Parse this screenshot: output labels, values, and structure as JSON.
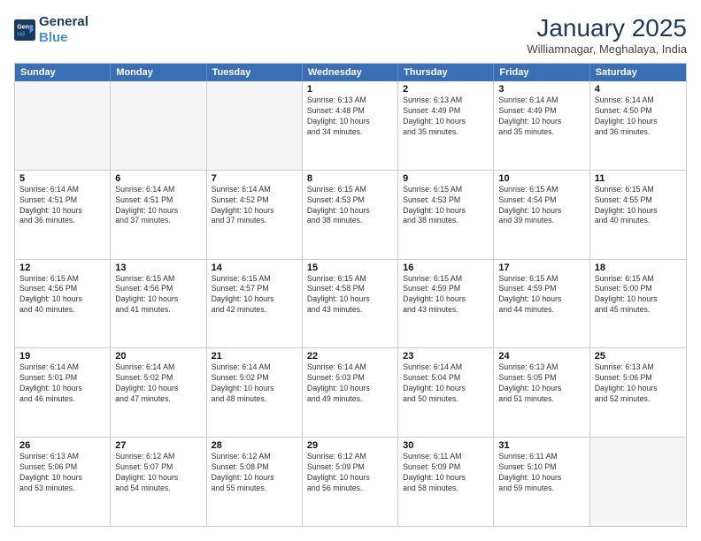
{
  "header": {
    "logo_line1": "General",
    "logo_line2": "Blue",
    "title": "January 2025",
    "subtitle": "Williamnagar, Meghalaya, India"
  },
  "days_of_week": [
    "Sunday",
    "Monday",
    "Tuesday",
    "Wednesday",
    "Thursday",
    "Friday",
    "Saturday"
  ],
  "rows": [
    [
      {
        "day": "",
        "info": ""
      },
      {
        "day": "",
        "info": ""
      },
      {
        "day": "",
        "info": ""
      },
      {
        "day": "1",
        "info": "Sunrise: 6:13 AM\nSunset: 4:48 PM\nDaylight: 10 hours\nand 34 minutes."
      },
      {
        "day": "2",
        "info": "Sunrise: 6:13 AM\nSunset: 4:49 PM\nDaylight: 10 hours\nand 35 minutes."
      },
      {
        "day": "3",
        "info": "Sunrise: 6:14 AM\nSunset: 4:49 PM\nDaylight: 10 hours\nand 35 minutes."
      },
      {
        "day": "4",
        "info": "Sunrise: 6:14 AM\nSunset: 4:50 PM\nDaylight: 10 hours\nand 36 minutes."
      }
    ],
    [
      {
        "day": "5",
        "info": "Sunrise: 6:14 AM\nSunset: 4:51 PM\nDaylight: 10 hours\nand 36 minutes."
      },
      {
        "day": "6",
        "info": "Sunrise: 6:14 AM\nSunset: 4:51 PM\nDaylight: 10 hours\nand 37 minutes."
      },
      {
        "day": "7",
        "info": "Sunrise: 6:14 AM\nSunset: 4:52 PM\nDaylight: 10 hours\nand 37 minutes."
      },
      {
        "day": "8",
        "info": "Sunrise: 6:15 AM\nSunset: 4:53 PM\nDaylight: 10 hours\nand 38 minutes."
      },
      {
        "day": "9",
        "info": "Sunrise: 6:15 AM\nSunset: 4:53 PM\nDaylight: 10 hours\nand 38 minutes."
      },
      {
        "day": "10",
        "info": "Sunrise: 6:15 AM\nSunset: 4:54 PM\nDaylight: 10 hours\nand 39 minutes."
      },
      {
        "day": "11",
        "info": "Sunrise: 6:15 AM\nSunset: 4:55 PM\nDaylight: 10 hours\nand 40 minutes."
      }
    ],
    [
      {
        "day": "12",
        "info": "Sunrise: 6:15 AM\nSunset: 4:56 PM\nDaylight: 10 hours\nand 40 minutes."
      },
      {
        "day": "13",
        "info": "Sunrise: 6:15 AM\nSunset: 4:56 PM\nDaylight: 10 hours\nand 41 minutes."
      },
      {
        "day": "14",
        "info": "Sunrise: 6:15 AM\nSunset: 4:57 PM\nDaylight: 10 hours\nand 42 minutes."
      },
      {
        "day": "15",
        "info": "Sunrise: 6:15 AM\nSunset: 4:58 PM\nDaylight: 10 hours\nand 43 minutes."
      },
      {
        "day": "16",
        "info": "Sunrise: 6:15 AM\nSunset: 4:59 PM\nDaylight: 10 hours\nand 43 minutes."
      },
      {
        "day": "17",
        "info": "Sunrise: 6:15 AM\nSunset: 4:59 PM\nDaylight: 10 hours\nand 44 minutes."
      },
      {
        "day": "18",
        "info": "Sunrise: 6:15 AM\nSunset: 5:00 PM\nDaylight: 10 hours\nand 45 minutes."
      }
    ],
    [
      {
        "day": "19",
        "info": "Sunrise: 6:14 AM\nSunset: 5:01 PM\nDaylight: 10 hours\nand 46 minutes."
      },
      {
        "day": "20",
        "info": "Sunrise: 6:14 AM\nSunset: 5:02 PM\nDaylight: 10 hours\nand 47 minutes."
      },
      {
        "day": "21",
        "info": "Sunrise: 6:14 AM\nSunset: 5:02 PM\nDaylight: 10 hours\nand 48 minutes."
      },
      {
        "day": "22",
        "info": "Sunrise: 6:14 AM\nSunset: 5:03 PM\nDaylight: 10 hours\nand 49 minutes."
      },
      {
        "day": "23",
        "info": "Sunrise: 6:14 AM\nSunset: 5:04 PM\nDaylight: 10 hours\nand 50 minutes."
      },
      {
        "day": "24",
        "info": "Sunrise: 6:13 AM\nSunset: 5:05 PM\nDaylight: 10 hours\nand 51 minutes."
      },
      {
        "day": "25",
        "info": "Sunrise: 6:13 AM\nSunset: 5:06 PM\nDaylight: 10 hours\nand 52 minutes."
      }
    ],
    [
      {
        "day": "26",
        "info": "Sunrise: 6:13 AM\nSunset: 5:06 PM\nDaylight: 10 hours\nand 53 minutes."
      },
      {
        "day": "27",
        "info": "Sunrise: 6:12 AM\nSunset: 5:07 PM\nDaylight: 10 hours\nand 54 minutes."
      },
      {
        "day": "28",
        "info": "Sunrise: 6:12 AM\nSunset: 5:08 PM\nDaylight: 10 hours\nand 55 minutes."
      },
      {
        "day": "29",
        "info": "Sunrise: 6:12 AM\nSunset: 5:09 PM\nDaylight: 10 hours\nand 56 minutes."
      },
      {
        "day": "30",
        "info": "Sunrise: 6:11 AM\nSunset: 5:09 PM\nDaylight: 10 hours\nand 58 minutes."
      },
      {
        "day": "31",
        "info": "Sunrise: 6:11 AM\nSunset: 5:10 PM\nDaylight: 10 hours\nand 59 minutes."
      },
      {
        "day": "",
        "info": ""
      }
    ]
  ]
}
